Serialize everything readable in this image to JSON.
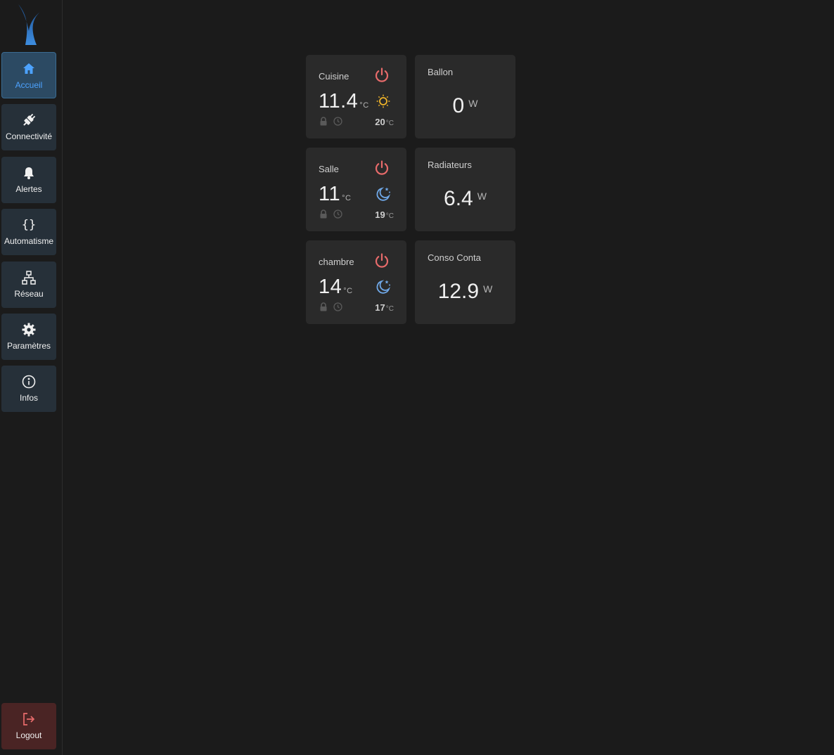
{
  "nav": {
    "items": [
      {
        "label": "Accueil",
        "icon": "home-icon",
        "active": true
      },
      {
        "label": "Connectivité",
        "icon": "plug-icon"
      },
      {
        "label": "Alertes",
        "icon": "bell-icon"
      },
      {
        "label": "Automatisme",
        "icon": "braces-icon"
      },
      {
        "label": "Réseau",
        "icon": "network-icon"
      },
      {
        "label": "Paramètres",
        "icon": "gear-icon"
      },
      {
        "label": "Infos",
        "icon": "info-icon"
      }
    ],
    "logout_label": "Logout"
  },
  "thermostats": [
    {
      "name": "Cuisine",
      "temp": "11.4",
      "unit": "°C",
      "mode": "sun",
      "setpoint": "20",
      "setpoint_unit": "°C"
    },
    {
      "name": "Salle",
      "temp": "11",
      "unit": "°C",
      "mode": "moon",
      "setpoint": "19",
      "setpoint_unit": "°C"
    },
    {
      "name": "chambre",
      "temp": "14",
      "unit": "°C",
      "mode": "moon",
      "setpoint": "17",
      "setpoint_unit": "°C"
    }
  ],
  "power": [
    {
      "name": "Ballon",
      "value": "0",
      "unit": "W"
    },
    {
      "name": "Radiateurs",
      "value": "6.4",
      "unit": "W"
    },
    {
      "name": "Conso Conta",
      "value": "12.9",
      "unit": "W"
    }
  ],
  "colors": {
    "accent": "#4da3ff",
    "power_icon": "#e86b6b",
    "sun_icon": "#f0b429",
    "moon_icon": "#6fa8e8",
    "nav_bg": "#263039",
    "nav_active_bg": "#2c4a63",
    "logout_bg": "#4a2424",
    "card_bg": "#2a2a2a"
  }
}
